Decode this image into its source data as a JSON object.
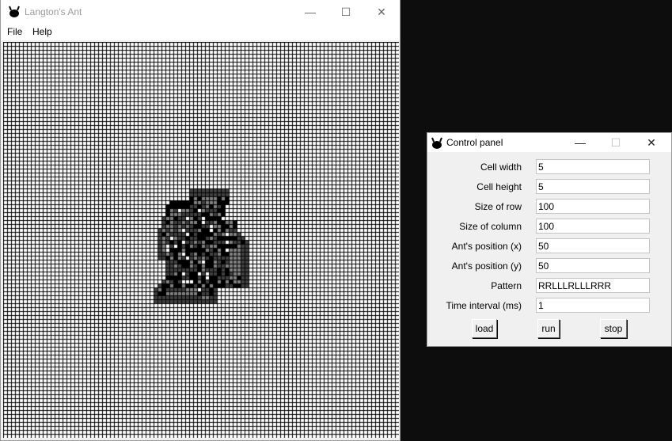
{
  "main_window": {
    "title": "Langton's Ant",
    "controls": {
      "minimize": "—",
      "maximize": "☐",
      "close": "✕"
    },
    "menu": [
      "File",
      "Help"
    ]
  },
  "grid": {
    "size": 100,
    "background": "#ffffff",
    "line_color": "#000000",
    "state_colors": [
      "#ffffff",
      "#808080",
      "#404040",
      "#000000"
    ]
  },
  "control_panel": {
    "title": "Control panel",
    "controls": {
      "minimize": "—",
      "maximize": "☐",
      "close": "✕"
    },
    "fields": [
      {
        "label": "Cell width",
        "value": "5"
      },
      {
        "label": "Cell height",
        "value": "5"
      },
      {
        "label": "Size of row",
        "value": "100"
      },
      {
        "label": "Size of column",
        "value": "100"
      },
      {
        "label": "Ant's position (x)",
        "value": "50"
      },
      {
        "label": "Ant's position (y)",
        "value": "50"
      },
      {
        "label": "Pattern",
        "value": "RRLLLRLLLRRR"
      },
      {
        "label": "Time interval (ms)",
        "value": "1"
      }
    ],
    "buttons": {
      "load": "load",
      "run": "run",
      "stop": "stop"
    }
  }
}
